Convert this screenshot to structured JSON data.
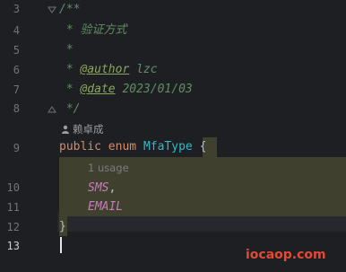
{
  "gutter": {
    "line_numbers": [
      "3",
      "4",
      "5",
      "6",
      "7",
      "8",
      "9",
      "10",
      "11",
      "12",
      "13"
    ]
  },
  "code": {
    "l3": "/**",
    "l4": " * 验证方式",
    "l5": " *",
    "l6_prefix": " * ",
    "l6_tag": "@author",
    "l6_value": " lzc",
    "l7_prefix": " * ",
    "l7_tag": "@date",
    "l7_value": " 2023/01/03",
    "l8": " */",
    "author_hint": "赖卓成",
    "l9_public": "public",
    "l9_enum": "enum",
    "l9_name": "MfaType",
    "l9_brace": "{",
    "usage_hint": "1 usage",
    "l10": "SMS",
    "l10_comma": ",",
    "l11": "EMAIL",
    "l12": "}"
  },
  "watermark": "iocaop.com",
  "colors": {
    "background": "#1e1f22",
    "comment": "#5f8e63",
    "keyword": "#cf8e6d",
    "class_name": "#2fbac8",
    "constant": "#c77dbb",
    "highlight": "#40402f",
    "watermark": "#e34935"
  }
}
